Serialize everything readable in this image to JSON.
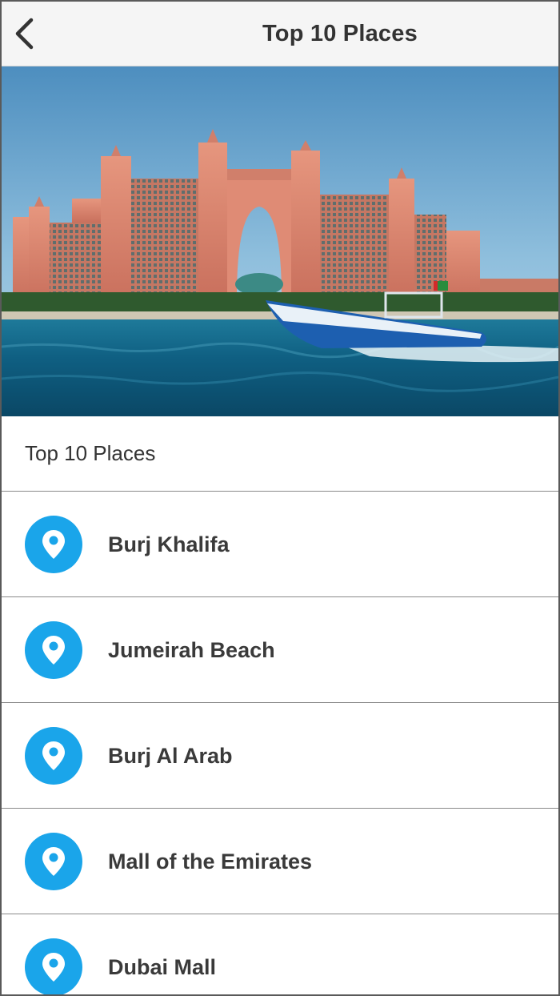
{
  "header": {
    "title": "Top 10 Places",
    "back_icon": "chevron-left-icon"
  },
  "hero": {
    "image": "photo of a pink palace-style resort hotel with central arch behind blue sea and a speedboat"
  },
  "section": {
    "title": "Top 10 Places"
  },
  "places": [
    {
      "label": "Burj Khalifa",
      "icon": "map-pin-icon"
    },
    {
      "label": "Jumeirah Beach",
      "icon": "map-pin-icon"
    },
    {
      "label": "Burj Al Arab",
      "icon": "map-pin-icon"
    },
    {
      "label": "Mall of the Emirates",
      "icon": "map-pin-icon"
    },
    {
      "label": "Dubai Mall",
      "icon": "map-pin-icon"
    }
  ],
  "colors": {
    "accent": "#1aa5ea",
    "navbar_bg": "#f5f5f5",
    "text": "#333333"
  }
}
